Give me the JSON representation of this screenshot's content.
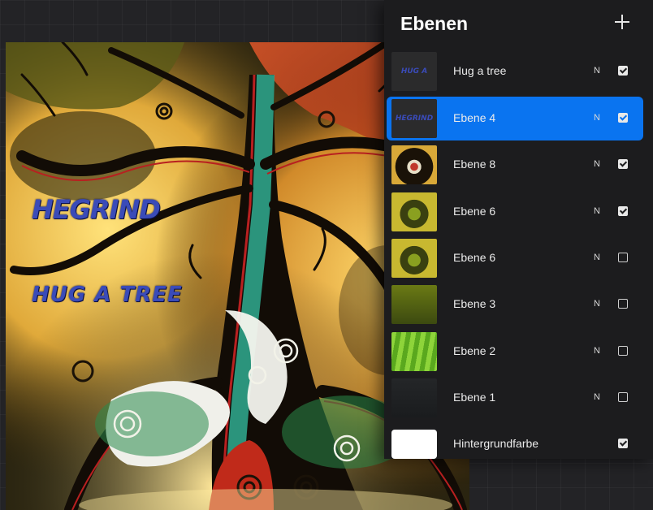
{
  "panel": {
    "title": "Ebenen",
    "layers": [
      {
        "name": "Hug a tree",
        "blend": "N",
        "visible": true,
        "selected": false,
        "thumb_text": "HUG A TREE",
        "thumb": "text"
      },
      {
        "name": "Ebene 4",
        "blend": "N",
        "visible": true,
        "selected": true,
        "thumb_text": "HEGRIND",
        "thumb": "text"
      },
      {
        "name": "Ebene 8",
        "blend": "N",
        "visible": true,
        "selected": false,
        "thumb": "art-dark"
      },
      {
        "name": "Ebene 6",
        "blend": "N",
        "visible": true,
        "selected": false,
        "thumb": "art-yellow"
      },
      {
        "name": "Ebene 6",
        "blend": "N",
        "visible": false,
        "selected": false,
        "thumb": "art-yellow"
      },
      {
        "name": "Ebene 3",
        "blend": "N",
        "visible": false,
        "selected": false,
        "thumb": "art-olive"
      },
      {
        "name": "Ebene 2",
        "blend": "N",
        "visible": false,
        "selected": false,
        "thumb": "art-green"
      },
      {
        "name": "Ebene 1",
        "blend": "N",
        "visible": false,
        "selected": false,
        "thumb": "art-sketch"
      },
      {
        "name": "Hintergrundfarbe",
        "blend": "",
        "visible": true,
        "selected": false,
        "thumb": "white"
      }
    ]
  },
  "canvas": {
    "watermark_logo": "HEGRIND",
    "watermark_slogan": "HUG A TREE"
  },
  "colors": {
    "accent": "#0a74f0",
    "panel_bg": "#1c1c1e",
    "watermark": "#3a4bb8"
  }
}
